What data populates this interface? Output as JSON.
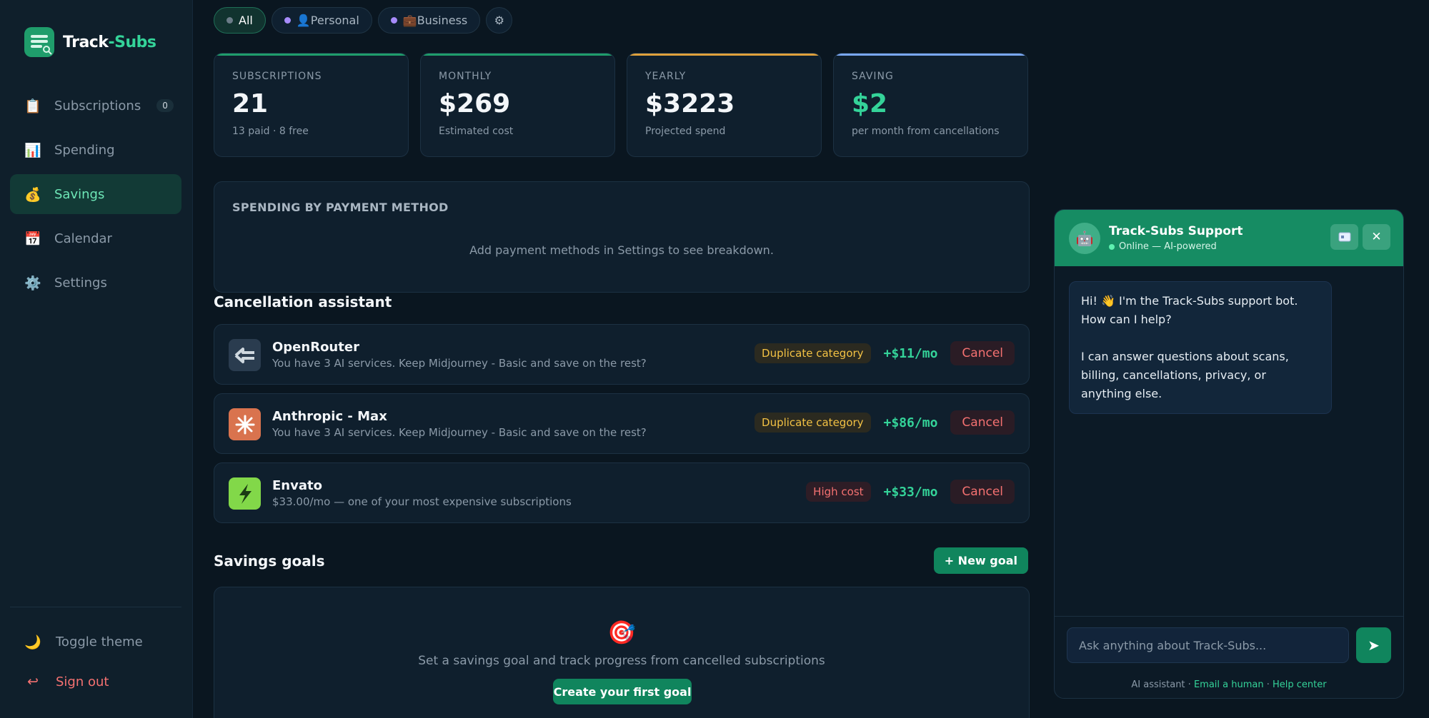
{
  "app": {
    "name_main": "Track",
    "name_accent": "-Subs"
  },
  "sidebar": {
    "items": [
      {
        "label": "Subscriptions",
        "icon": "clipboard-icon",
        "glyph": "📋",
        "count": "0"
      },
      {
        "label": "Spending",
        "icon": "bar-chart-icon",
        "glyph": "📊"
      },
      {
        "label": "Savings",
        "icon": "money-bag-icon",
        "glyph": "💰",
        "active": true
      },
      {
        "label": "Calendar",
        "icon": "calendar-icon",
        "glyph": "📅"
      },
      {
        "label": "Settings",
        "icon": "gear-icon",
        "glyph": "⚙️"
      }
    ],
    "toggle_theme": "Toggle theme",
    "sign_out": "Sign out"
  },
  "filters": {
    "all": "All",
    "personal": "👤Personal",
    "business": "💼Business",
    "gear": "⚙"
  },
  "stats": [
    {
      "label": "SUBSCRIPTIONS",
      "value": "21",
      "sub": "13 paid · 8 free",
      "accent": "#1f9d6b"
    },
    {
      "label": "MONTHLY",
      "value": "$269",
      "sub": "Estimated cost",
      "accent": "#1f9d6b"
    },
    {
      "label": "YEARLY",
      "value": "$3223",
      "sub": "Projected spend",
      "accent": "#e0a13c"
    },
    {
      "label": "SAVING",
      "value": "$2",
      "sub": "per month from cancellations",
      "accent": "#7aa7f2"
    }
  ],
  "payment_methods": {
    "title": "SPENDING BY PAYMENT METHOD",
    "empty": "Add payment methods in Settings to see breakdown."
  },
  "cancellation": {
    "title": "Cancellation assistant",
    "items": [
      {
        "name": "OpenRouter",
        "desc": "You have 3 AI services. Keep Midjourney - Basic and save on the rest?",
        "tag": "Duplicate category",
        "tag_type": "dup",
        "saving": "+$11/mo",
        "cancel": "Cancel"
      },
      {
        "name": "Anthropic - Max",
        "desc": "You have 3 AI services. Keep Midjourney - Basic and save on the rest?",
        "tag": "Duplicate category",
        "tag_type": "dup",
        "saving": "+$86/mo",
        "cancel": "Cancel"
      },
      {
        "name": "Envato",
        "desc": "$33.00/mo — one of your most expensive subscriptions",
        "tag": "High cost",
        "tag_type": "high",
        "saving": "+$33/mo",
        "cancel": "Cancel"
      }
    ]
  },
  "goals": {
    "title": "Savings goals",
    "new_goal": "+ New goal",
    "empty_icon": "🎯",
    "empty_text": "Set a savings goal and track progress from cancelled subscriptions",
    "create": "Create your first goal"
  },
  "chat": {
    "title": "Track-Subs Support",
    "status": "Online — AI-powered",
    "avatar": "🤖",
    "message_1": "Hi! 👋 I'm the Track-Subs support bot. How can I help?",
    "message_2": "I can answer questions about scans, billing, cancellations, privacy, or anything else.",
    "input_placeholder": "Ask anything about Track-Subs...",
    "footer_prefix": "AI assistant · ",
    "email_link": "Email a human",
    "sep": " · ",
    "help_link": "Help center"
  }
}
